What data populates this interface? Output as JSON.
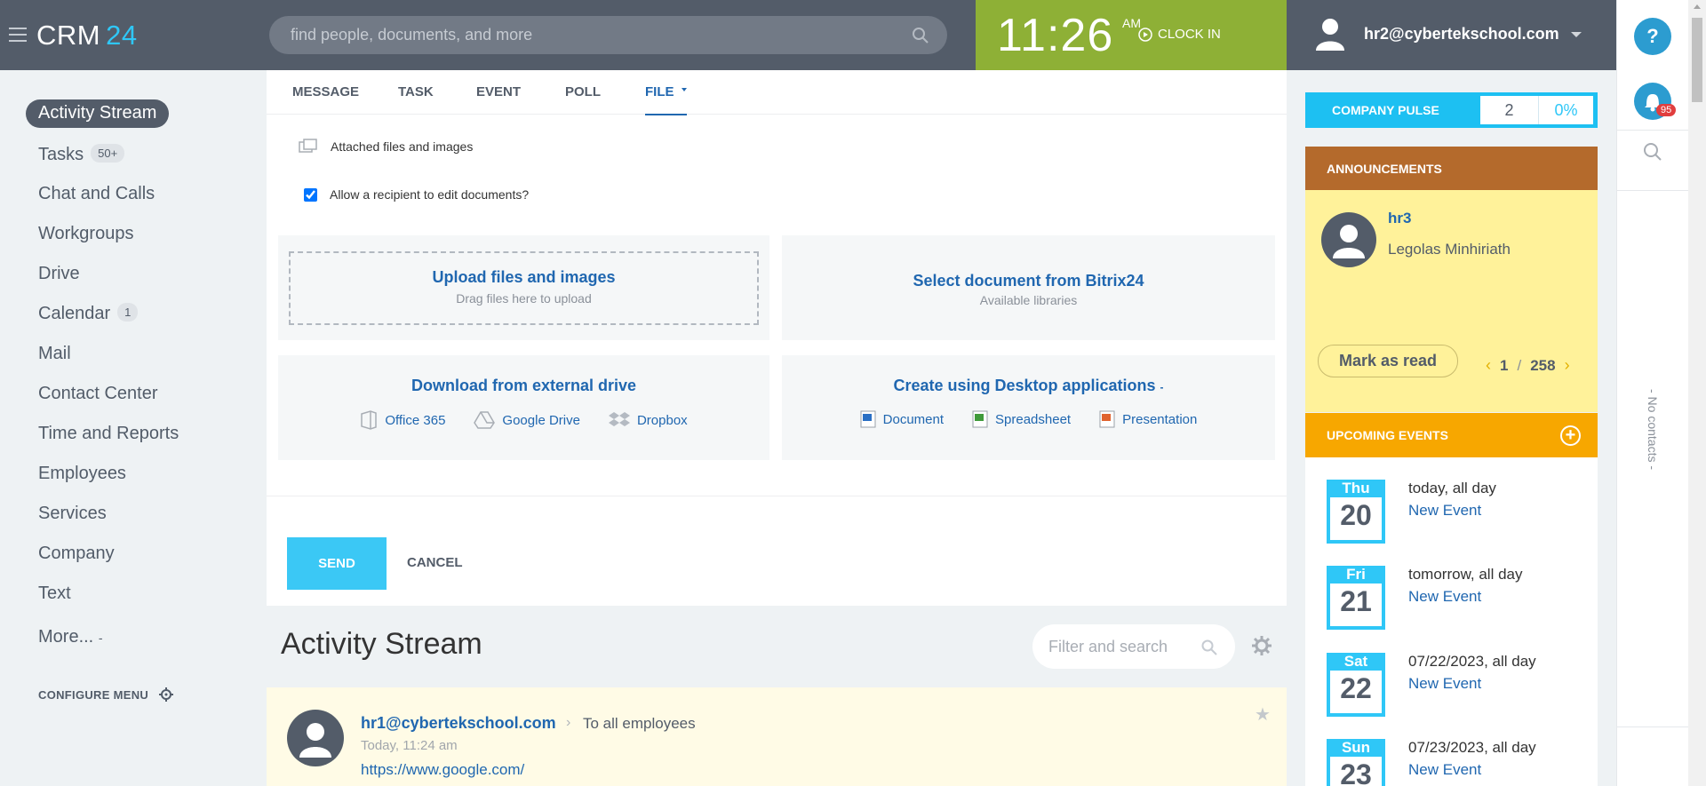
{
  "header": {
    "logo_text": "CRM",
    "logo_num": "24",
    "search_placeholder": "find people, documents, and more",
    "time": "11:26",
    "ampm": "AM",
    "clock_in": "CLOCK IN",
    "user_email": "hr2@cyberteks chool.com"
  },
  "sidebar": {
    "items": [
      {
        "label": "Activity Stream"
      },
      {
        "label": "Tasks",
        "counter": "50+"
      },
      {
        "label": "Chat and Calls"
      },
      {
        "label": "Workgroups"
      },
      {
        "label": "Drive"
      },
      {
        "label": "Calendar",
        "counter": "1"
      },
      {
        "label": "Mail"
      },
      {
        "label": "Contact Center"
      },
      {
        "label": "Time and Reports"
      },
      {
        "label": "Employees"
      },
      {
        "label": "Services"
      },
      {
        "label": "Company"
      },
      {
        "label": "Text"
      },
      {
        "label": "More..."
      }
    ],
    "configure_menu": "CONFIGURE MENU"
  },
  "composer": {
    "tabs": [
      "MESSAGE",
      "TASK",
      "EVENT",
      "POLL",
      "FILE"
    ],
    "attached_label": "Attached files and images",
    "allow_edit_label": "Allow a recipient to edit documents?",
    "upload_title": "Upload files and images",
    "upload_sub": "Drag files here to upload",
    "select_title": "Select document from Bitrix24",
    "select_sub": "Available libraries",
    "external_title": "Download from external drive",
    "external_links": [
      "Office 365",
      "Google Drive",
      "Dropbox"
    ],
    "create_title": "Create using Desktop applications",
    "create_links": [
      "Document",
      "Spreadsheet",
      "Presentation"
    ],
    "send": "SEND",
    "cancel": "CANCEL"
  },
  "stream": {
    "title": "Activity Stream",
    "filter_placeholder": "Filter and search",
    "post": {
      "author": "hr1@cybertekschool.com",
      "to": "To all employees",
      "time": "Today, 11:24 am",
      "link": "https://www.google.com/"
    }
  },
  "right": {
    "pulse_label": "COMPANY PULSE",
    "pulse_value": "2",
    "pulse_percent": "0%",
    "announcements_label": "ANNOUNCEMENTS",
    "ann_name": "hr3",
    "ann_sub": "Legolas Minhiriath",
    "mark_read": "Mark as read",
    "page_current": "1",
    "page_total": "258",
    "events_label": "UPCOMING EVENTS",
    "events": [
      {
        "dow": "Thu",
        "day": "20",
        "when": "today, all day",
        "name": "New Event"
      },
      {
        "dow": "Fri",
        "day": "21",
        "when": "tomorrow, all day",
        "name": "New Event"
      },
      {
        "dow": "Sat",
        "day": "22",
        "when": "07/22/2023, all day",
        "name": "New Event"
      },
      {
        "dow": "Sun",
        "day": "23",
        "when": "07/23/2023, all day",
        "name": "New Event"
      }
    ]
  },
  "rbar": {
    "help": "?",
    "notif_count": "95",
    "no_contacts": "- No contacts -"
  }
}
